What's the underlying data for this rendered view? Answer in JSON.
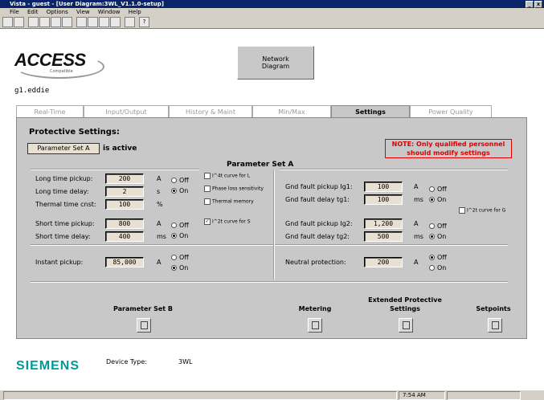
{
  "window": {
    "title": "Vista - guest - [User Diagram:3WL_V1.1.0-setup]"
  },
  "menu": [
    "File",
    "Edit",
    "Options",
    "View",
    "Window",
    "Help"
  ],
  "header": {
    "logo_text": "ACCESS",
    "logo_sub": "Compatible",
    "network_button": "Network Diagram",
    "device_name": "g1.eddie"
  },
  "tabs": [
    {
      "label": "Real-Time",
      "active": false
    },
    {
      "label": "Input/Output",
      "active": false
    },
    {
      "label": "History & Maint",
      "active": false
    },
    {
      "label": "Min/Max",
      "active": false
    },
    {
      "label": "Settings",
      "active": true
    },
    {
      "label": "Power Quality",
      "active": false
    }
  ],
  "settings": {
    "title": "Protective Settings:",
    "param_button": "Parameter Set A",
    "active_text": "is active",
    "note": "NOTE: Only qualified personnel should modify settings",
    "section_title": "Parameter Set A",
    "long_time_pickup": {
      "label": "Long time pickup:",
      "value": "200",
      "unit": "A"
    },
    "long_time_delay": {
      "label": "Long time delay:",
      "value": "2",
      "unit": "s"
    },
    "thermal_time_cnst": {
      "label": "Thermal time cnst:",
      "value": "100",
      "unit": "%"
    },
    "short_time_pickup": {
      "label": "Short time pickup:",
      "value": "800",
      "unit": "A"
    },
    "short_time_delay": {
      "label": "Short time delay:",
      "value": "400",
      "unit": "ms"
    },
    "instant_pickup": {
      "label": "Instant pickup:",
      "value": "85,000",
      "unit": "A"
    },
    "gnd_pickup_1": {
      "label": "Gnd fault pickup Ig1:",
      "value": "100",
      "unit": "A"
    },
    "gnd_delay_1": {
      "label": "Gnd fault delay tg1:",
      "value": "100",
      "unit": "ms"
    },
    "gnd_pickup_2": {
      "label": "Gnd fault pickup Ig2:",
      "value": "1,200",
      "unit": "A"
    },
    "gnd_delay_2": {
      "label": "Gnd fault delay tg2:",
      "value": "500",
      "unit": "ms"
    },
    "neutral": {
      "label": "Neutral protection:",
      "value": "200",
      "unit": "A"
    },
    "radio_off": "Off",
    "radio_on": "On",
    "chk_i4t": "I^4t curve for L",
    "chk_phase": "Phase loss sensitivity",
    "chk_thermal": "Thermal memory",
    "chk_i2t_s": "I^2t curve for S",
    "chk_i2t_g": "I^2t curve for G"
  },
  "nav": [
    {
      "label": "Parameter Set B"
    },
    {
      "label": "Metering"
    },
    {
      "label": "Extended Protective Settings"
    },
    {
      "label": "Setpoints"
    }
  ],
  "footer": {
    "brand": "SIEMENS",
    "device_type_label": "Device Type:",
    "device_type_value": "3WL"
  },
  "status": {
    "time": "7:54 AM"
  },
  "colors": {
    "note": "#e00000",
    "brand": "#009999",
    "titlebar": "#0a246a"
  }
}
